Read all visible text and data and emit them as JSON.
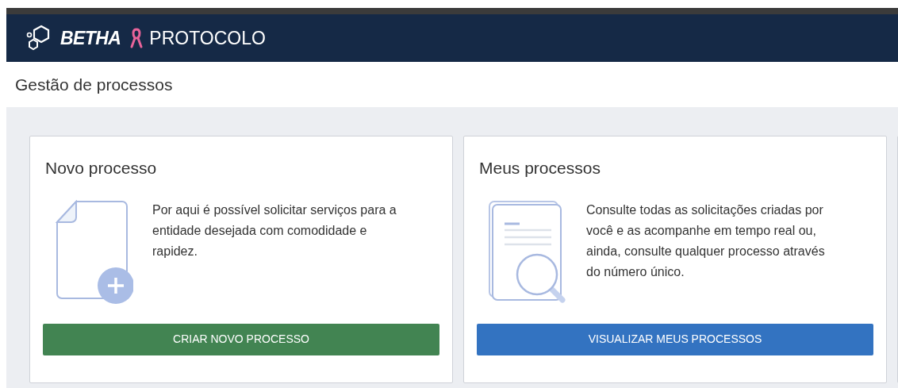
{
  "header": {
    "brand": "BETHA",
    "product": "PROTOCOLO"
  },
  "page_title": "Gestão de processos",
  "cards": [
    {
      "kind": "create",
      "title": "Novo processo",
      "description": "Por aqui é possível solicitar serviços para a entidade desejada com comodidade e rapidez.",
      "button": {
        "label": "CRIAR NOVO PROCESSO"
      }
    },
    {
      "kind": "view",
      "title": "Meus processos",
      "description": "Consulte todas as solicitações criadas por você e as acompanhe em tempo real ou, ainda, consulte qualquer processo através do número único.",
      "button": {
        "label": "VISUALIZAR MEUS PROCESSOS"
      }
    }
  ]
}
